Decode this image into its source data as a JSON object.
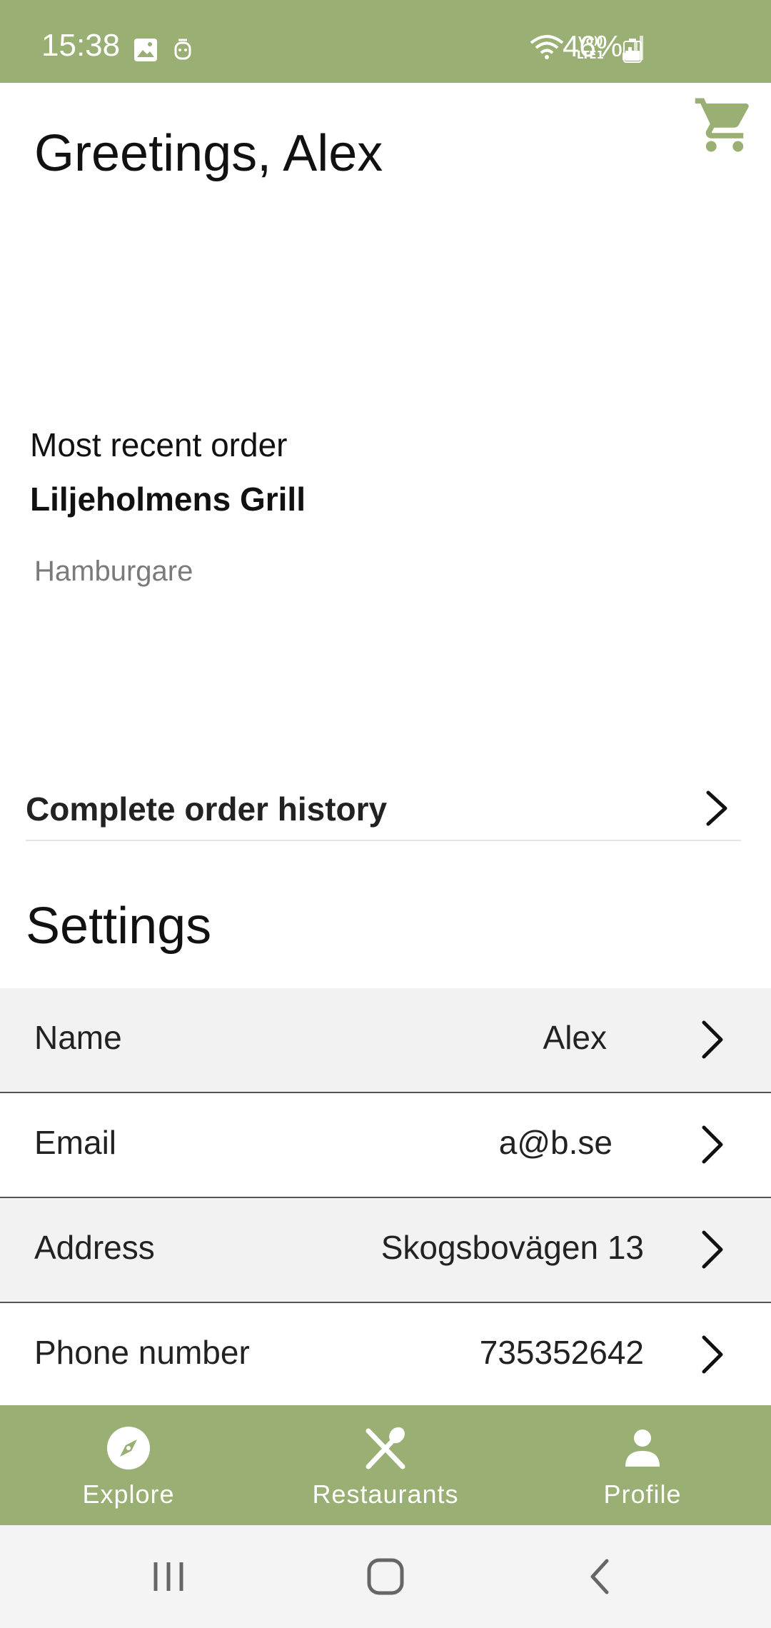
{
  "status_bar": {
    "time": "15:38",
    "battery_percent": "46%",
    "icons": [
      "gallery-icon",
      "notification-icon",
      "wifi-icon",
      "volte-icon",
      "signal-icon",
      "battery-icon"
    ],
    "background_color": "#9aaf73"
  },
  "header": {
    "greeting": "Greetings, Alex",
    "cart_icon": "shopping-cart-icon"
  },
  "recent_order": {
    "label": "Most recent order",
    "restaurant": "Liljeholmens Grill",
    "item": "Hamburgare"
  },
  "order_history": {
    "label": "Complete order history"
  },
  "settings": {
    "title": "Settings",
    "rows": [
      {
        "label": "Name",
        "value": "Alex"
      },
      {
        "label": "Email",
        "value": "a@b.se"
      },
      {
        "label": "Address",
        "value": "Skogsbovägen 13"
      },
      {
        "label": "Phone number",
        "value": "735352642"
      }
    ]
  },
  "bottom_nav": {
    "items": [
      {
        "label": "Explore",
        "icon": "compass-icon"
      },
      {
        "label": "Restaurants",
        "icon": "fork-knife-icon"
      },
      {
        "label": "Profile",
        "icon": "person-icon"
      }
    ],
    "background_color": "#9aaf73"
  },
  "system_nav": {
    "buttons": [
      "recent-apps-icon",
      "home-icon",
      "back-icon"
    ]
  }
}
